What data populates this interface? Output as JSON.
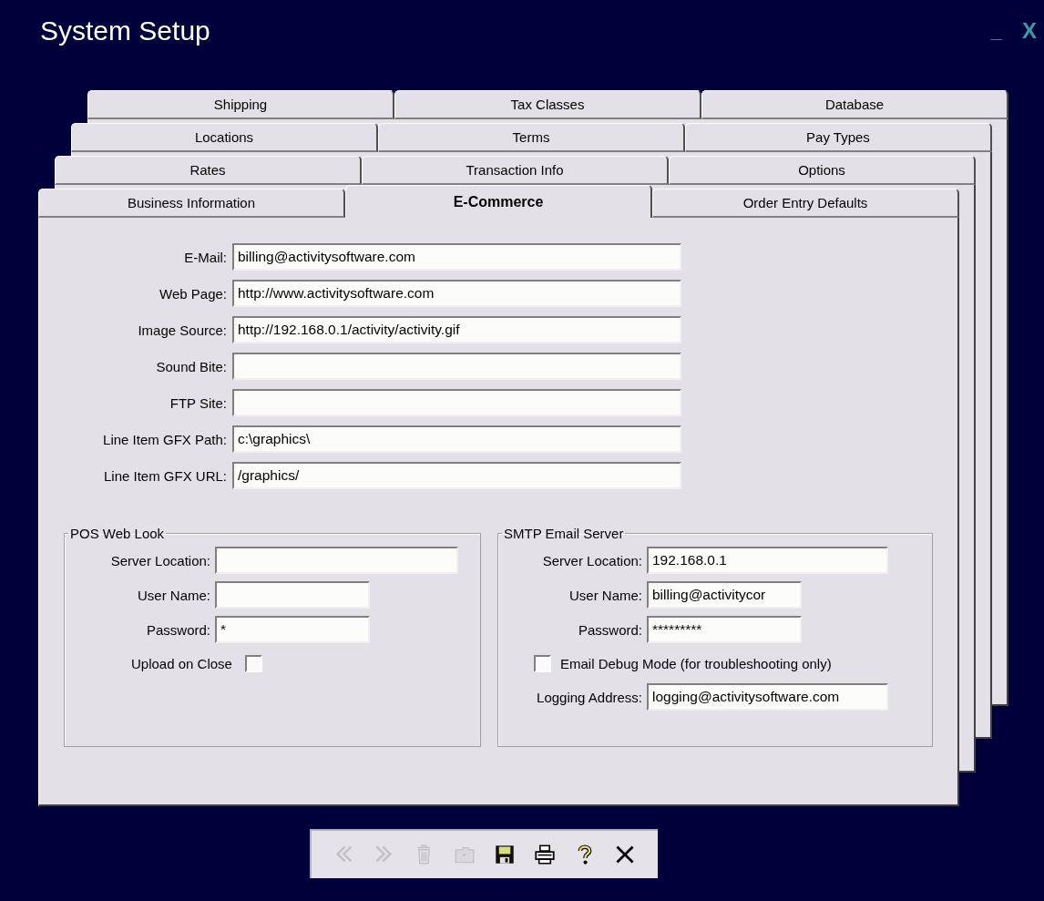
{
  "window": {
    "title": "System Setup",
    "minimize": "_",
    "close": "X"
  },
  "tab_rows": [
    [
      {
        "label": "Shipping",
        "selected": false
      },
      {
        "label": "Tax Classes",
        "selected": false
      },
      {
        "label": "Database",
        "selected": false
      }
    ],
    [
      {
        "label": "Locations",
        "selected": false
      },
      {
        "label": "Terms",
        "selected": false
      },
      {
        "label": "Pay Types",
        "selected": false
      }
    ],
    [
      {
        "label": "Rates",
        "selected": false
      },
      {
        "label": "Transaction Info",
        "selected": false
      },
      {
        "label": "Options",
        "selected": false
      }
    ],
    [
      {
        "label": "Business Information",
        "selected": false
      },
      {
        "label": "E-Commerce",
        "selected": true
      },
      {
        "label": "Order Entry Defaults",
        "selected": false
      }
    ]
  ],
  "fields": [
    {
      "label": "E-Mail:",
      "value": "billing@activitysoftware.com"
    },
    {
      "label": "Web Page:",
      "value": "http://www.activitysoftware.com"
    },
    {
      "label": "Image Source:",
      "value": "http://192.168.0.1/activity/activity.gif"
    },
    {
      "label": "Sound Bite:"
    },
    {
      "label": "FTP Site:"
    },
    {
      "label": "Line Item GFX Path:",
      "value": "c:\\graphics\\"
    },
    {
      "label": "Line Item GFX URL:",
      "value": "/graphics/"
    }
  ],
  "groups": [
    {
      "title": "POS Web Look",
      "rows": [
        {
          "kind": "long_field",
          "label": "Server Location:"
        },
        {
          "kind": "short_field",
          "label": "User Name:"
        },
        {
          "kind": "short_field",
          "label": "Password:",
          "value": "*"
        },
        {
          "kind": "check_after",
          "label": "Upload on Close",
          "checked": false
        }
      ]
    },
    {
      "title": "SMTP Email Server",
      "rows": [
        {
          "kind": "long_field",
          "label": "Server Location:",
          "value": "192.168.0.1"
        },
        {
          "kind": "short_field",
          "label": "User Name:",
          "value": "billing@activitycor"
        },
        {
          "kind": "short_field",
          "label": "Password:",
          "value": "*********"
        },
        {
          "kind": "check_before",
          "label": "Email Debug Mode (for troubleshooting only)",
          "checked": false
        },
        {
          "kind": "long_field",
          "label": "Logging Address:",
          "value": "logging@activitysoftware.com"
        }
      ]
    }
  ],
  "toolbar": [
    {
      "kind": "previous",
      "disabled": true
    },
    {
      "kind": "next",
      "disabled": true
    },
    {
      "kind": "delete",
      "disabled": true
    },
    {
      "kind": "folder",
      "disabled": true
    },
    {
      "kind": "save",
      "disabled": false
    },
    {
      "kind": "print",
      "disabled": false
    },
    {
      "kind": "help",
      "disabled": false
    },
    {
      "kind": "close",
      "disabled": false
    }
  ]
}
